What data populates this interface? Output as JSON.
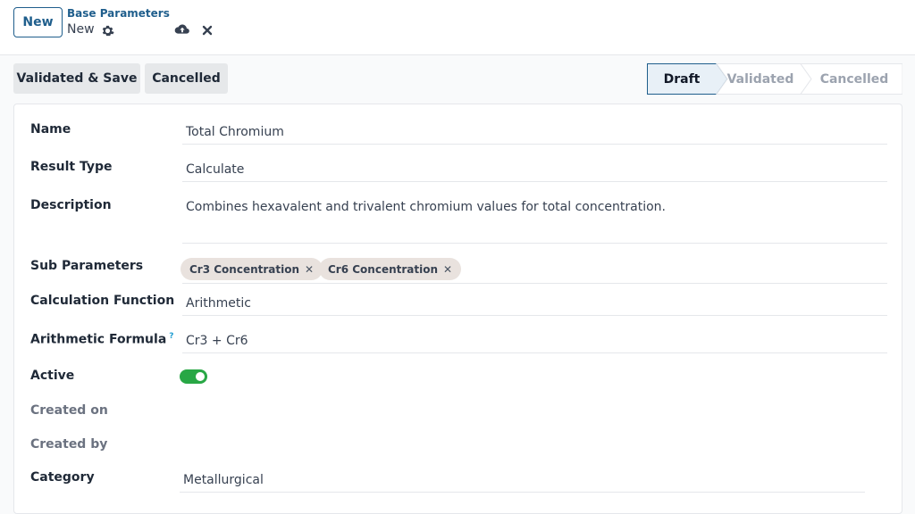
{
  "header": {
    "new_label": "New",
    "breadcrumb_parent": "Base Parameters",
    "breadcrumb_current": "New"
  },
  "actions": {
    "validate_save": "Validated & Save",
    "cancelled": "Cancelled"
  },
  "statusbar": {
    "stages": [
      {
        "label": "Draft",
        "active": true
      },
      {
        "label": "Validated",
        "active": false
      },
      {
        "label": "Cancelled",
        "active": false
      }
    ]
  },
  "form": {
    "name_label": "Name",
    "name_value": "Total Chromium",
    "result_type_label": "Result Type",
    "result_type_value": "Calculate",
    "description_label": "Description",
    "description_value": "Combines hexavalent and trivalent chromium values for total concentration.",
    "sub_parameters_label": "Sub Parameters",
    "sub_parameters": [
      "Cr3 Concentration",
      "Cr6 Concentration"
    ],
    "calc_function_label": "Calculation Function",
    "calc_function_value": "Arithmetic",
    "formula_label": "Arithmetic Formula",
    "formula_help": "?",
    "formula_value": "Cr3 + Cr6",
    "active_label": "Active",
    "active": true,
    "created_on_label": "Created on",
    "created_by_label": "Created by",
    "category_label": "Category",
    "category_value": "Metallurgical"
  },
  "colors": {
    "primary": "#1f5e8c",
    "toggle_on": "#28a745",
    "tag_bg": "#e9e2de"
  },
  "icons": {
    "gear": "gear-icon",
    "save": "cloud-upload-icon",
    "discard": "close-icon",
    "tag_remove": "close-icon"
  }
}
